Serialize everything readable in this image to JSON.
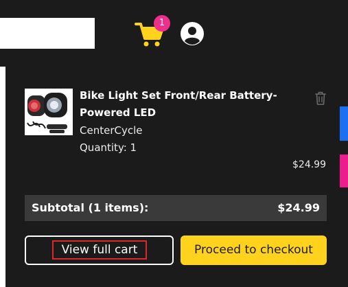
{
  "header": {
    "search": {
      "value": "",
      "placeholder": ""
    },
    "cart_badge": "1",
    "icons": {
      "cart": "cart-icon",
      "user": "user-account-icon"
    }
  },
  "cart": {
    "item": {
      "title": "Bike Light Set Front/Rear Battery-Powered LED",
      "brand": "CenterCycle",
      "quantity_label": "Quantity: 1",
      "price": "$24.99",
      "thumbnail": "bike-light-set-image",
      "delete_icon": "trash-icon"
    },
    "subtotal_label": "Subtotal (1 items):",
    "subtotal_value": "$24.99",
    "view_cart_label": "View full cart",
    "checkout_label": "Proceed to checkout"
  },
  "colors": {
    "panel_bg": "#1b1b1b",
    "accent_yellow": "#ffd21d",
    "badge_pink": "#ef2f8c",
    "side_blue": "#1a6ff2",
    "side_pink": "#ec1e8e",
    "subtotal_bg": "#3a3a3a",
    "focus_red": "#e0262b"
  }
}
